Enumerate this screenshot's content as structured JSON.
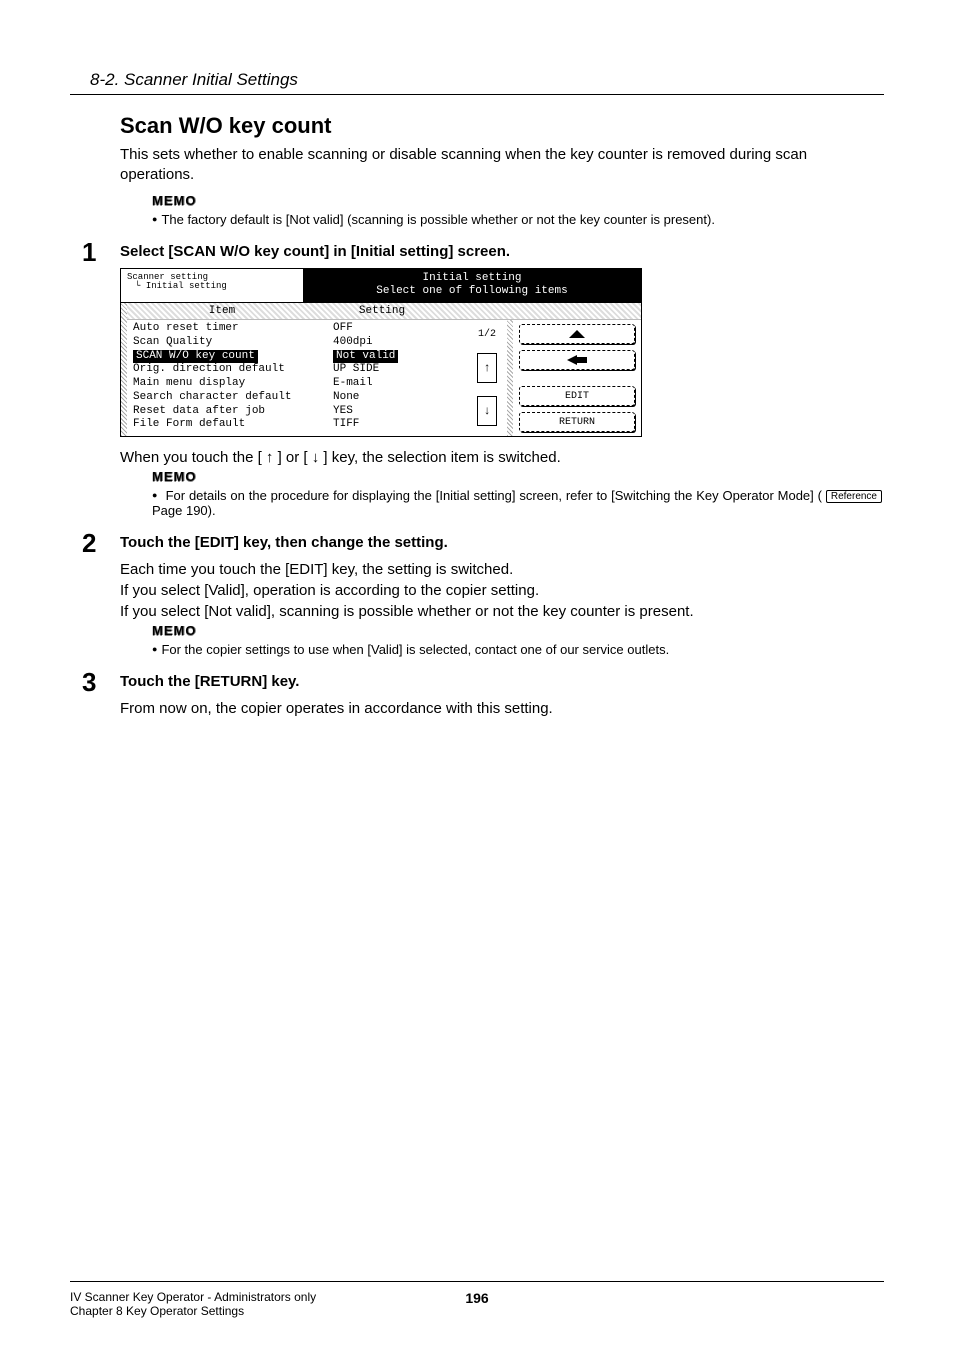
{
  "breadcrumb": "8-2. Scanner Initial Settings",
  "title": "Scan W/O key count",
  "intro": "This sets whether to enable scanning or disable scanning when the key counter is removed during scan operations.",
  "memo_label": "MEMO",
  "intro_memo": "The factory default is [Not valid] (scanning is possible whether or not the key counter is present).",
  "steps": {
    "s1": {
      "num": "1",
      "title": "Select [SCAN W/O key count] in [Initial setting] screen.",
      "after_lcd": "When you touch the [ ↑ ] or [ ↓ ] key, the selection item is switched.",
      "memo": "For details on the procedure for displaying the [Initial setting] screen, refer to [Switching the Key Operator Mode] (",
      "ref_label": "Reference",
      "ref_tail": "  Page 190)."
    },
    "s2": {
      "num": "2",
      "title": "Touch the [EDIT] key, then change the setting.",
      "line1": "Each time you touch the [EDIT] key, the setting is switched.",
      "line2": "If you select [Valid], operation is according to the copier setting.",
      "line3": "If you select [Not valid], scanning is possible whether or not the key counter is present.",
      "memo": "For the copier settings to use when [Valid] is selected, contact one of our service outlets."
    },
    "s3": {
      "num": "3",
      "title": "Touch the [RETURN] key.",
      "line1": "From now on, the copier operates in accordance with this setting."
    }
  },
  "lcd": {
    "crumb1": "Scanner setting",
    "crumb2": "Initial setting",
    "banner_line1": "Initial setting",
    "banner_line2": "Select one of following items",
    "col_item": "Item",
    "col_setting": "Setting",
    "page_indicator": "1/2",
    "items": [
      "Auto reset timer",
      "Scan Quality",
      "SCAN W/O key count",
      "Orig. direction default",
      "Main menu display",
      "Search character default",
      "Reset data after job",
      "File Form default"
    ],
    "settings": [
      "OFF",
      "400dpi",
      "Not valid",
      "UP SIDE",
      "E-mail",
      "None",
      "YES",
      "TIFF"
    ],
    "selected_index": 2,
    "buttons": {
      "edit": "EDIT",
      "return": "RETURN",
      "up": "↑",
      "down": "↓"
    }
  },
  "footer": {
    "left1": "IV Scanner Key Operator - Administrators only",
    "left2": "Chapter 8 Key Operator Settings",
    "page": "196"
  }
}
